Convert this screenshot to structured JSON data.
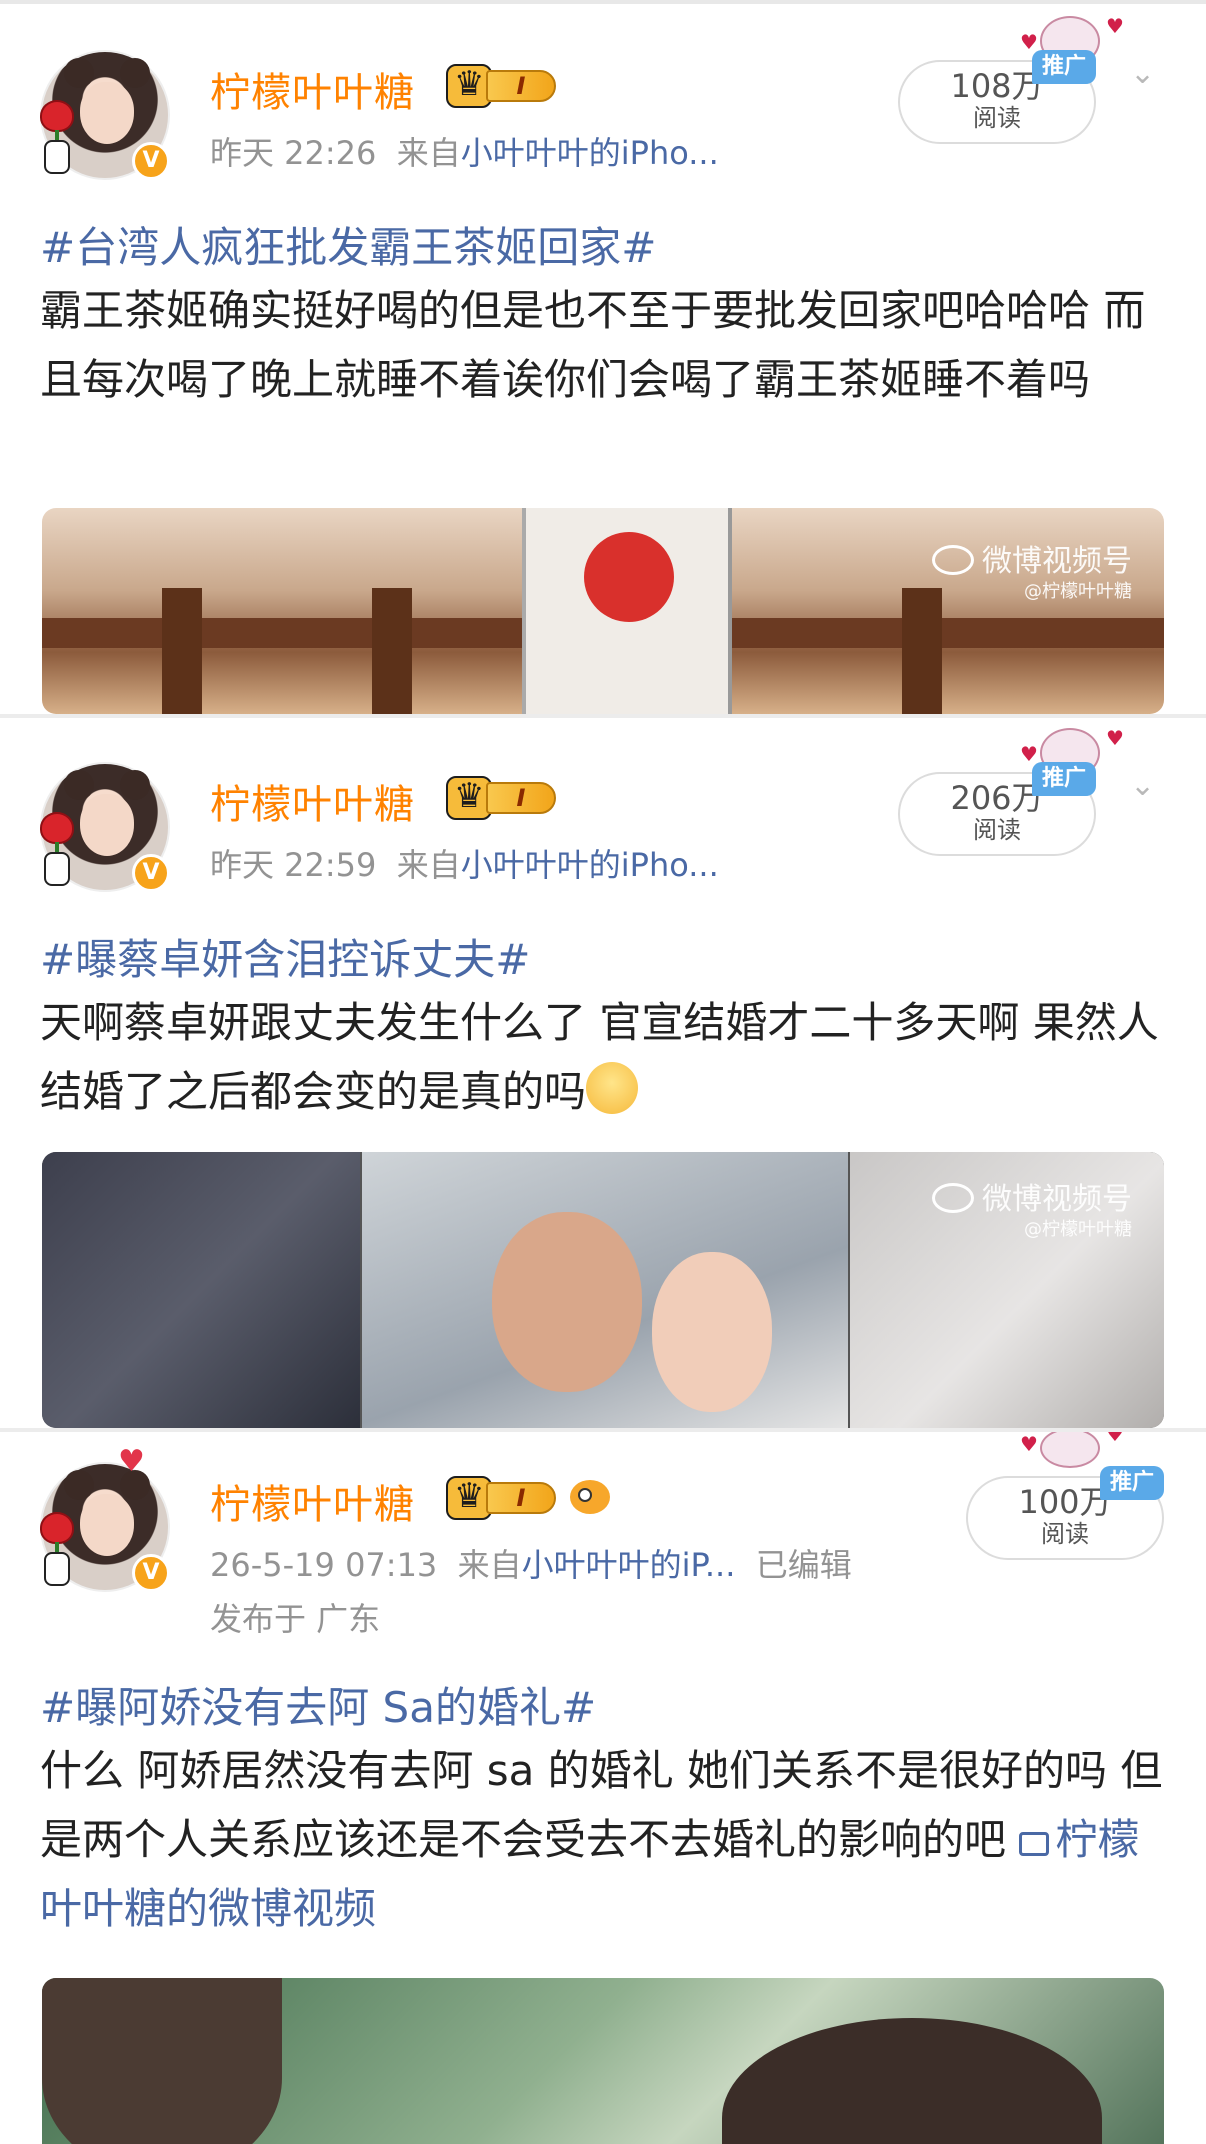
{
  "posts": [
    {
      "username": "柠檬叶叶糖",
      "level_badge": "I",
      "meta_time": "昨天 22:26",
      "meta_from_label": "来自",
      "meta_source": "小叶叶叶的iPho...",
      "reads_count": "108万",
      "reads_label": "阅读",
      "ad_label": "推广",
      "topic": "#台湾人疯狂批发霸王茶姬回家#",
      "body": "霸王茶姬确实挺好喝的但是也不至于要批发回家吧哈哈哈 而且每次喝了晚上就睡不着诶你们会喝了霸王茶姬睡不着吗",
      "watermark_main": "微博视频号",
      "watermark_sub": "@柠檬叶叶糖"
    },
    {
      "username": "柠檬叶叶糖",
      "level_badge": "I",
      "meta_time": "昨天 22:59",
      "meta_from_label": "来自",
      "meta_source": "小叶叶叶的iPho...",
      "reads_count": "206万",
      "reads_label": "阅读",
      "ad_label": "推广",
      "topic": "#曝蔡卓妍含泪控诉丈夫#",
      "body": "天啊蔡卓妍跟丈夫发生什么了  官宣结婚才二十多天啊 果然人结婚了之后都会变的是真的吗",
      "watermark_main": "微博视频号",
      "watermark_sub": "@柠檬叶叶糖"
    },
    {
      "username": "柠檬叶叶糖",
      "level_badge": "I",
      "meta_time": "26-5-19 07:13",
      "meta_from_label": "来自",
      "meta_source": "小叶叶叶的iP...",
      "meta_edited": "已编辑",
      "meta_location": "发布于 广东",
      "reads_count": "100万",
      "reads_label": "阅读",
      "ad_label": "推广",
      "topic": "#曝阿娇没有去阿 Sa的婚礼#",
      "body": "什么 阿娇居然没有去阿 sa 的婚礼 她们关系不是很好的吗 但是两个人关系应该还是不会受去不去婚礼的影响的吧",
      "video_link": "柠檬叶叶糖的微博视频"
    }
  ],
  "colors": {
    "username": "#ff8200",
    "link": "#4a69a5",
    "meta": "#939393",
    "ad_badge": "#5aa9e8",
    "verified": "#f7a31a"
  },
  "icons": [
    "verified-v-icon",
    "crown-icon",
    "chevron-down-icon",
    "fish-icon",
    "heart-icon",
    "weibo-logo-icon",
    "video-camera-icon",
    "smile-emoji-icon"
  ]
}
